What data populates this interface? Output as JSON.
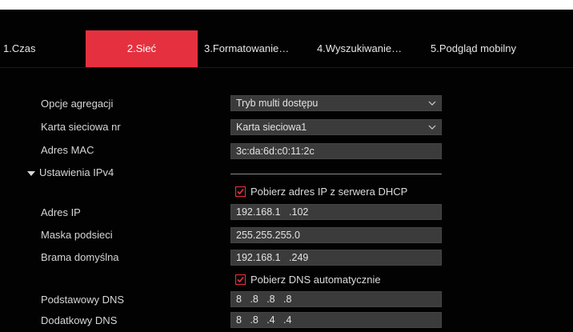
{
  "tabs": [
    {
      "label": "1.Czas"
    },
    {
      "label": "2.Sieć"
    },
    {
      "label": "3.Formatowanie…"
    },
    {
      "label": "4.Wyszukiwanie…"
    },
    {
      "label": "5.Podgląd mobilny"
    }
  ],
  "active_tab_color": "#e5313f",
  "form": {
    "aggregation": {
      "label": "Opcje agregacji",
      "value": "Tryb multi dostępu"
    },
    "nic": {
      "label": "Karta sieciowa nr",
      "value": "Karta sieciowa1"
    },
    "mac": {
      "label": "Adres MAC",
      "value": "3c:da:6d:c0:11:2c"
    },
    "ipv4_section": "Ustawienia IPv4",
    "dhcp": {
      "label": "Pobierz adres IP z serwera DHCP",
      "checked": true
    },
    "ip": {
      "label": "Adres IP",
      "value": "192.168.1   .102"
    },
    "mask": {
      "label": "Maska podsieci",
      "value": "255.255.255.0"
    },
    "gateway": {
      "label": "Brama domyślna",
      "value": "192.168.1   .249"
    },
    "auto_dns": {
      "label": "Pobierz DNS automatycznie",
      "checked": true
    },
    "dns1": {
      "label": "Podstawowy DNS",
      "value": "8   .8   .8   .8"
    },
    "dns2": {
      "label": "Dodatkowy DNS",
      "value": "8   .8   .4   .4"
    }
  }
}
